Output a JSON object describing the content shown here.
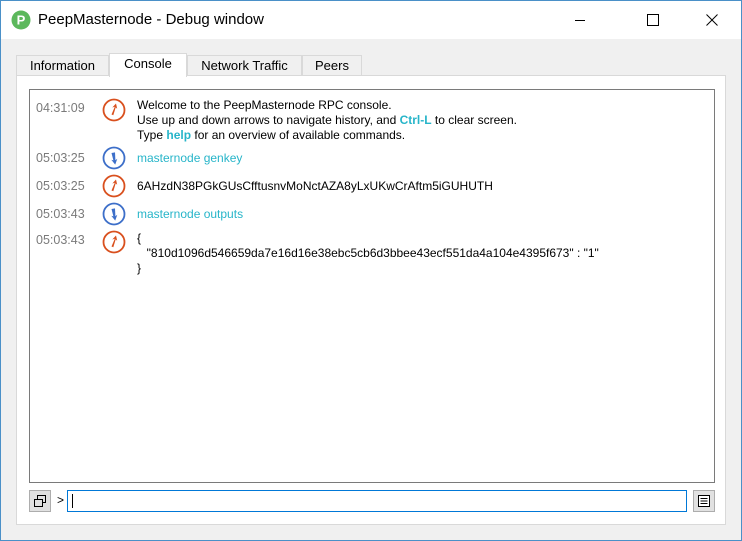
{
  "window": {
    "title": "PeepMasternode - Debug window",
    "app_icon_letter": "P",
    "brand_color": "#5cb85c"
  },
  "tabs": [
    {
      "label": "Information",
      "active": false
    },
    {
      "label": "Console",
      "active": true
    },
    {
      "label": "Network Traffic",
      "active": false
    },
    {
      "label": "Peers",
      "active": false
    }
  ],
  "console": {
    "entries": [
      {
        "time": "04:31:09",
        "direction": "reply",
        "icon": "reply-arrow-icon",
        "line1": "Welcome to the PeepMasternode RPC console.",
        "line2_a": "Use up and down arrows to navigate history, and ",
        "line2_kw": "Ctrl-L",
        "line2_b": " to clear screen.",
        "line3_a": "Type ",
        "line3_kw": "help",
        "line3_b": " for an overview of available commands."
      },
      {
        "time": "05:03:25",
        "direction": "request",
        "icon": "request-arrow-icon",
        "text": "masternode genkey"
      },
      {
        "time": "05:03:25",
        "direction": "reply",
        "icon": "reply-arrow-icon",
        "text": "6AHzdN38PGkGUsCfftusnvMoNctAZA8yLxUKwCrAftm5iGUHUTH"
      },
      {
        "time": "05:03:43",
        "direction": "request",
        "icon": "request-arrow-icon",
        "text": "masternode outputs"
      },
      {
        "time": "05:03:43",
        "direction": "reply",
        "icon": "reply-arrow-icon",
        "line1": "{",
        "line2": "  \"810d1096d546659da7e16d16e38ebc5cb6d3bbee43ecf551da4a104e4395f673\" : \"1\"",
        "line3": "}"
      }
    ],
    "colors": {
      "reply": "#d9501e",
      "request": "#3d6fc9",
      "command_text": "#27b5c9"
    }
  },
  "input": {
    "prompt": ">",
    "value": "",
    "placeholder": ""
  },
  "buttons": {
    "font_size_icon": "copy-window-icon",
    "clear_icon": "clear-console-icon"
  }
}
